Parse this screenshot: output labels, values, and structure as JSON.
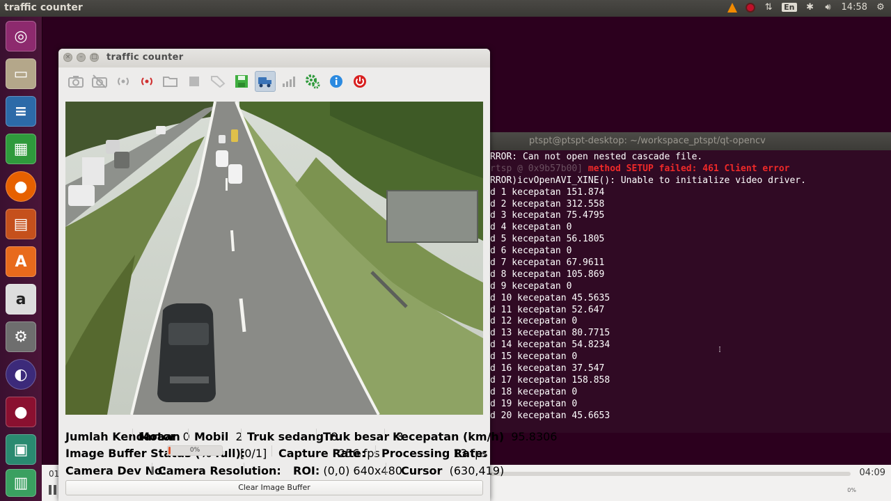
{
  "topbar": {
    "title": "traffic counter",
    "keyboard": "En",
    "clock": "14:58"
  },
  "window": {
    "title": "traffic counter"
  },
  "terminal": {
    "title": "ptspt@ptspt-desktop: ~/workspace_ptspt/qt-opencv",
    "lines": [
      {
        "text": "RROR: Can not open nested cascade file.",
        "style": "normal"
      },
      {
        "text": "rtsp @ 0x9b57b00] ",
        "style": "gray",
        "rest": "method SETUP failed: 461 Client error"
      },
      {
        "text": "RROR)icvOpenAVI_XINE(): Unable to initialize video driver.",
        "style": "normal"
      },
      {
        "text": "d 1 kecepatan 151.874",
        "style": "normal"
      },
      {
        "text": "d 2 kecepatan 312.558",
        "style": "normal"
      },
      {
        "text": "d 3 kecepatan 75.4795",
        "style": "normal"
      },
      {
        "text": "d 4 kecepatan 0",
        "style": "normal"
      },
      {
        "text": "d 5 kecepatan 56.1805",
        "style": "normal"
      },
      {
        "text": "d 6 kecepatan 0",
        "style": "normal"
      },
      {
        "text": "d 7 kecepatan 67.9611",
        "style": "normal"
      },
      {
        "text": "d 8 kecepatan 105.869",
        "style": "normal"
      },
      {
        "text": "d 9 kecepatan 0",
        "style": "normal"
      },
      {
        "text": "d 10 kecepatan 45.5635",
        "style": "normal"
      },
      {
        "text": "d 11 kecepatan 52.647",
        "style": "normal"
      },
      {
        "text": "d 12 kecepatan 0",
        "style": "normal"
      },
      {
        "text": "d 13 kecepatan 80.7715",
        "style": "normal"
      },
      {
        "text": "d 14 kecepatan 54.8234",
        "style": "normal"
      },
      {
        "text": "d 15 kecepatan 0",
        "style": "normal"
      },
      {
        "text": "d 16 kecepatan 37.547",
        "style": "normal"
      },
      {
        "text": "d 17 kecepatan 158.858",
        "style": "normal"
      },
      {
        "text": "d 18 kecepatan 0",
        "style": "normal"
      },
      {
        "text": "d 19 kecepatan 0",
        "style": "normal"
      },
      {
        "text": "d 20 kecepatan 45.6653",
        "style": "normal"
      }
    ]
  },
  "toolbar": {
    "buttons": [
      "camera-icon",
      "camera-off-icon",
      "stream-icon",
      "stream-active-icon",
      "open-folder-icon",
      "stop-icon",
      "tag-icon",
      "save-icon",
      "vehicle-count-icon",
      "chart-icon",
      "settings-icon",
      "info-icon",
      "power-icon"
    ],
    "active_index": 8
  },
  "stats": {
    "jumlah_label": "Jumlah Kendaraan",
    "motor_label": "Motor",
    "motor_value": "0",
    "mobil_label": "Mobil",
    "mobil_value": "2",
    "truk_sedang_label": "Truk sedang",
    "truk_sedang_value": "8",
    "truk_besar_label": "Truk besar",
    "truk_besar_value": "3",
    "kecepatan_label": "Kecepatan (km/h)",
    "kecepatan_value": "95.8306"
  },
  "status": {
    "buffer_label": "Image Buffer Status (% full):",
    "buffer_percent": "0%",
    "buffer_fraction": 0.0,
    "buffer_count": "[0/1]",
    "capture_label": "Capture Rate:",
    "capture_value": "256 fps",
    "processing_label": "Processing Rate:",
    "processing_value": "13 fps"
  },
  "camera": {
    "dev_label": "Camera Dev No:",
    "res_label": "Camera Resolution:",
    "roi_label": "ROI:",
    "roi_value": "(0,0) 640x480",
    "cursor_label": "Cursor",
    "cursor_value": "(630,419)"
  },
  "clear_button": "Clear Image Buffer",
  "player": {
    "elapsed": "01",
    "total": "04:09",
    "volume": "0%"
  }
}
